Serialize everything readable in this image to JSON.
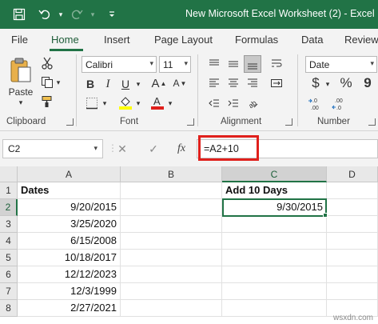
{
  "window": {
    "title": "New Microsoft Excel Worksheet (2)  -  Excel",
    "accent_color": "#217346"
  },
  "quick_access": {
    "save_icon": "save-icon",
    "undo_icon": "undo-icon",
    "redo_icon": "redo-icon"
  },
  "ribbon_tabs": [
    "File",
    "Home",
    "Insert",
    "Page Layout",
    "Formulas",
    "Data",
    "Review"
  ],
  "active_tab": "Home",
  "ribbon": {
    "clipboard": {
      "label": "Clipboard",
      "paste_label": "Paste"
    },
    "font": {
      "label": "Font",
      "family": "Calibri",
      "size": "11",
      "bold": "B",
      "italic": "I",
      "underline": "U",
      "grow": "A",
      "shrink": "A",
      "highlight_color": "#ffff00",
      "font_color": "#e0201c"
    },
    "alignment": {
      "label": "Alignment"
    },
    "number": {
      "label": "Number",
      "format": "Date",
      "currency": "$",
      "percent": "%",
      "comma": "9"
    }
  },
  "formula_bar": {
    "name_box": "C2",
    "cancel": "✕",
    "enter": "✓",
    "fx": "fx",
    "formula": "=A2+10",
    "highlight_color": "#e0201c"
  },
  "sheet": {
    "columns": [
      "A",
      "B",
      "C",
      "D"
    ],
    "selected_column": "C",
    "rows": [
      {
        "n": "1",
        "A": "Dates",
        "B": "",
        "C": "Add 10 Days",
        "D": ""
      },
      {
        "n": "2",
        "A": "9/20/2015",
        "B": "",
        "C": "9/30/2015",
        "D": ""
      },
      {
        "n": "3",
        "A": "3/25/2020",
        "B": "",
        "C": "",
        "D": ""
      },
      {
        "n": "4",
        "A": "6/15/2008",
        "B": "",
        "C": "",
        "D": ""
      },
      {
        "n": "5",
        "A": "10/18/2017",
        "B": "",
        "C": "",
        "D": ""
      },
      {
        "n": "6",
        "A": "12/12/2023",
        "B": "",
        "C": "",
        "D": ""
      },
      {
        "n": "7",
        "A": "12/3/1999",
        "B": "",
        "C": "",
        "D": ""
      },
      {
        "n": "8",
        "A": "2/27/2021",
        "B": "",
        "C": "",
        "D": ""
      }
    ],
    "active_cell": "C2"
  },
  "watermark": "wsxdn.com"
}
